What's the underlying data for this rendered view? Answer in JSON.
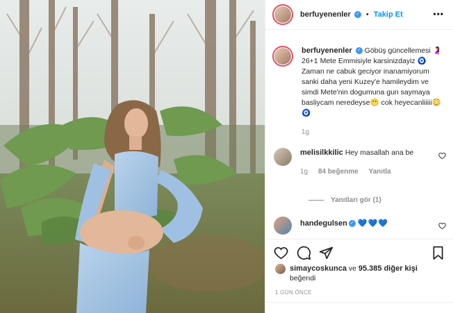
{
  "post": {
    "author": "berfuyenenler",
    "verified_symbol": "✓",
    "follow_label": "Takip Et",
    "more_label": "•••",
    "caption": "Göbüş güncellemesi 🤰 26+1 Mete Emmisiyle karsinizdayiz 🧿 Zaman ne cabuk geciyor inanamiyorum sanki daha yeni Kuzey'e hamileydim ve simdi Mete'nin dogumuna gun saymaya basliycam neredeyse😬 cok heyecanliiiii😳🧿",
    "caption_time": "1g"
  },
  "comments": [
    {
      "user": "melisilkkilic",
      "text": "Hey masallah ana be",
      "time": "1g",
      "likes": "84 beğenme",
      "reply_label": "Yanıtla",
      "view_replies_label": "Yanıtları gör (1)"
    },
    {
      "user": "handegulsen",
      "text": "💙💙💙"
    }
  ],
  "likes_line": {
    "user": "simaycoskunca",
    "connector": "ve",
    "others": "95.385 diğer kişi",
    "suffix": "beğendi"
  },
  "date_label": "1 GÜN ÖNCE",
  "colors": {
    "accent": "#0095f6",
    "verified": "#3897f0",
    "muted": "#8e8e8e",
    "text": "#262626"
  }
}
